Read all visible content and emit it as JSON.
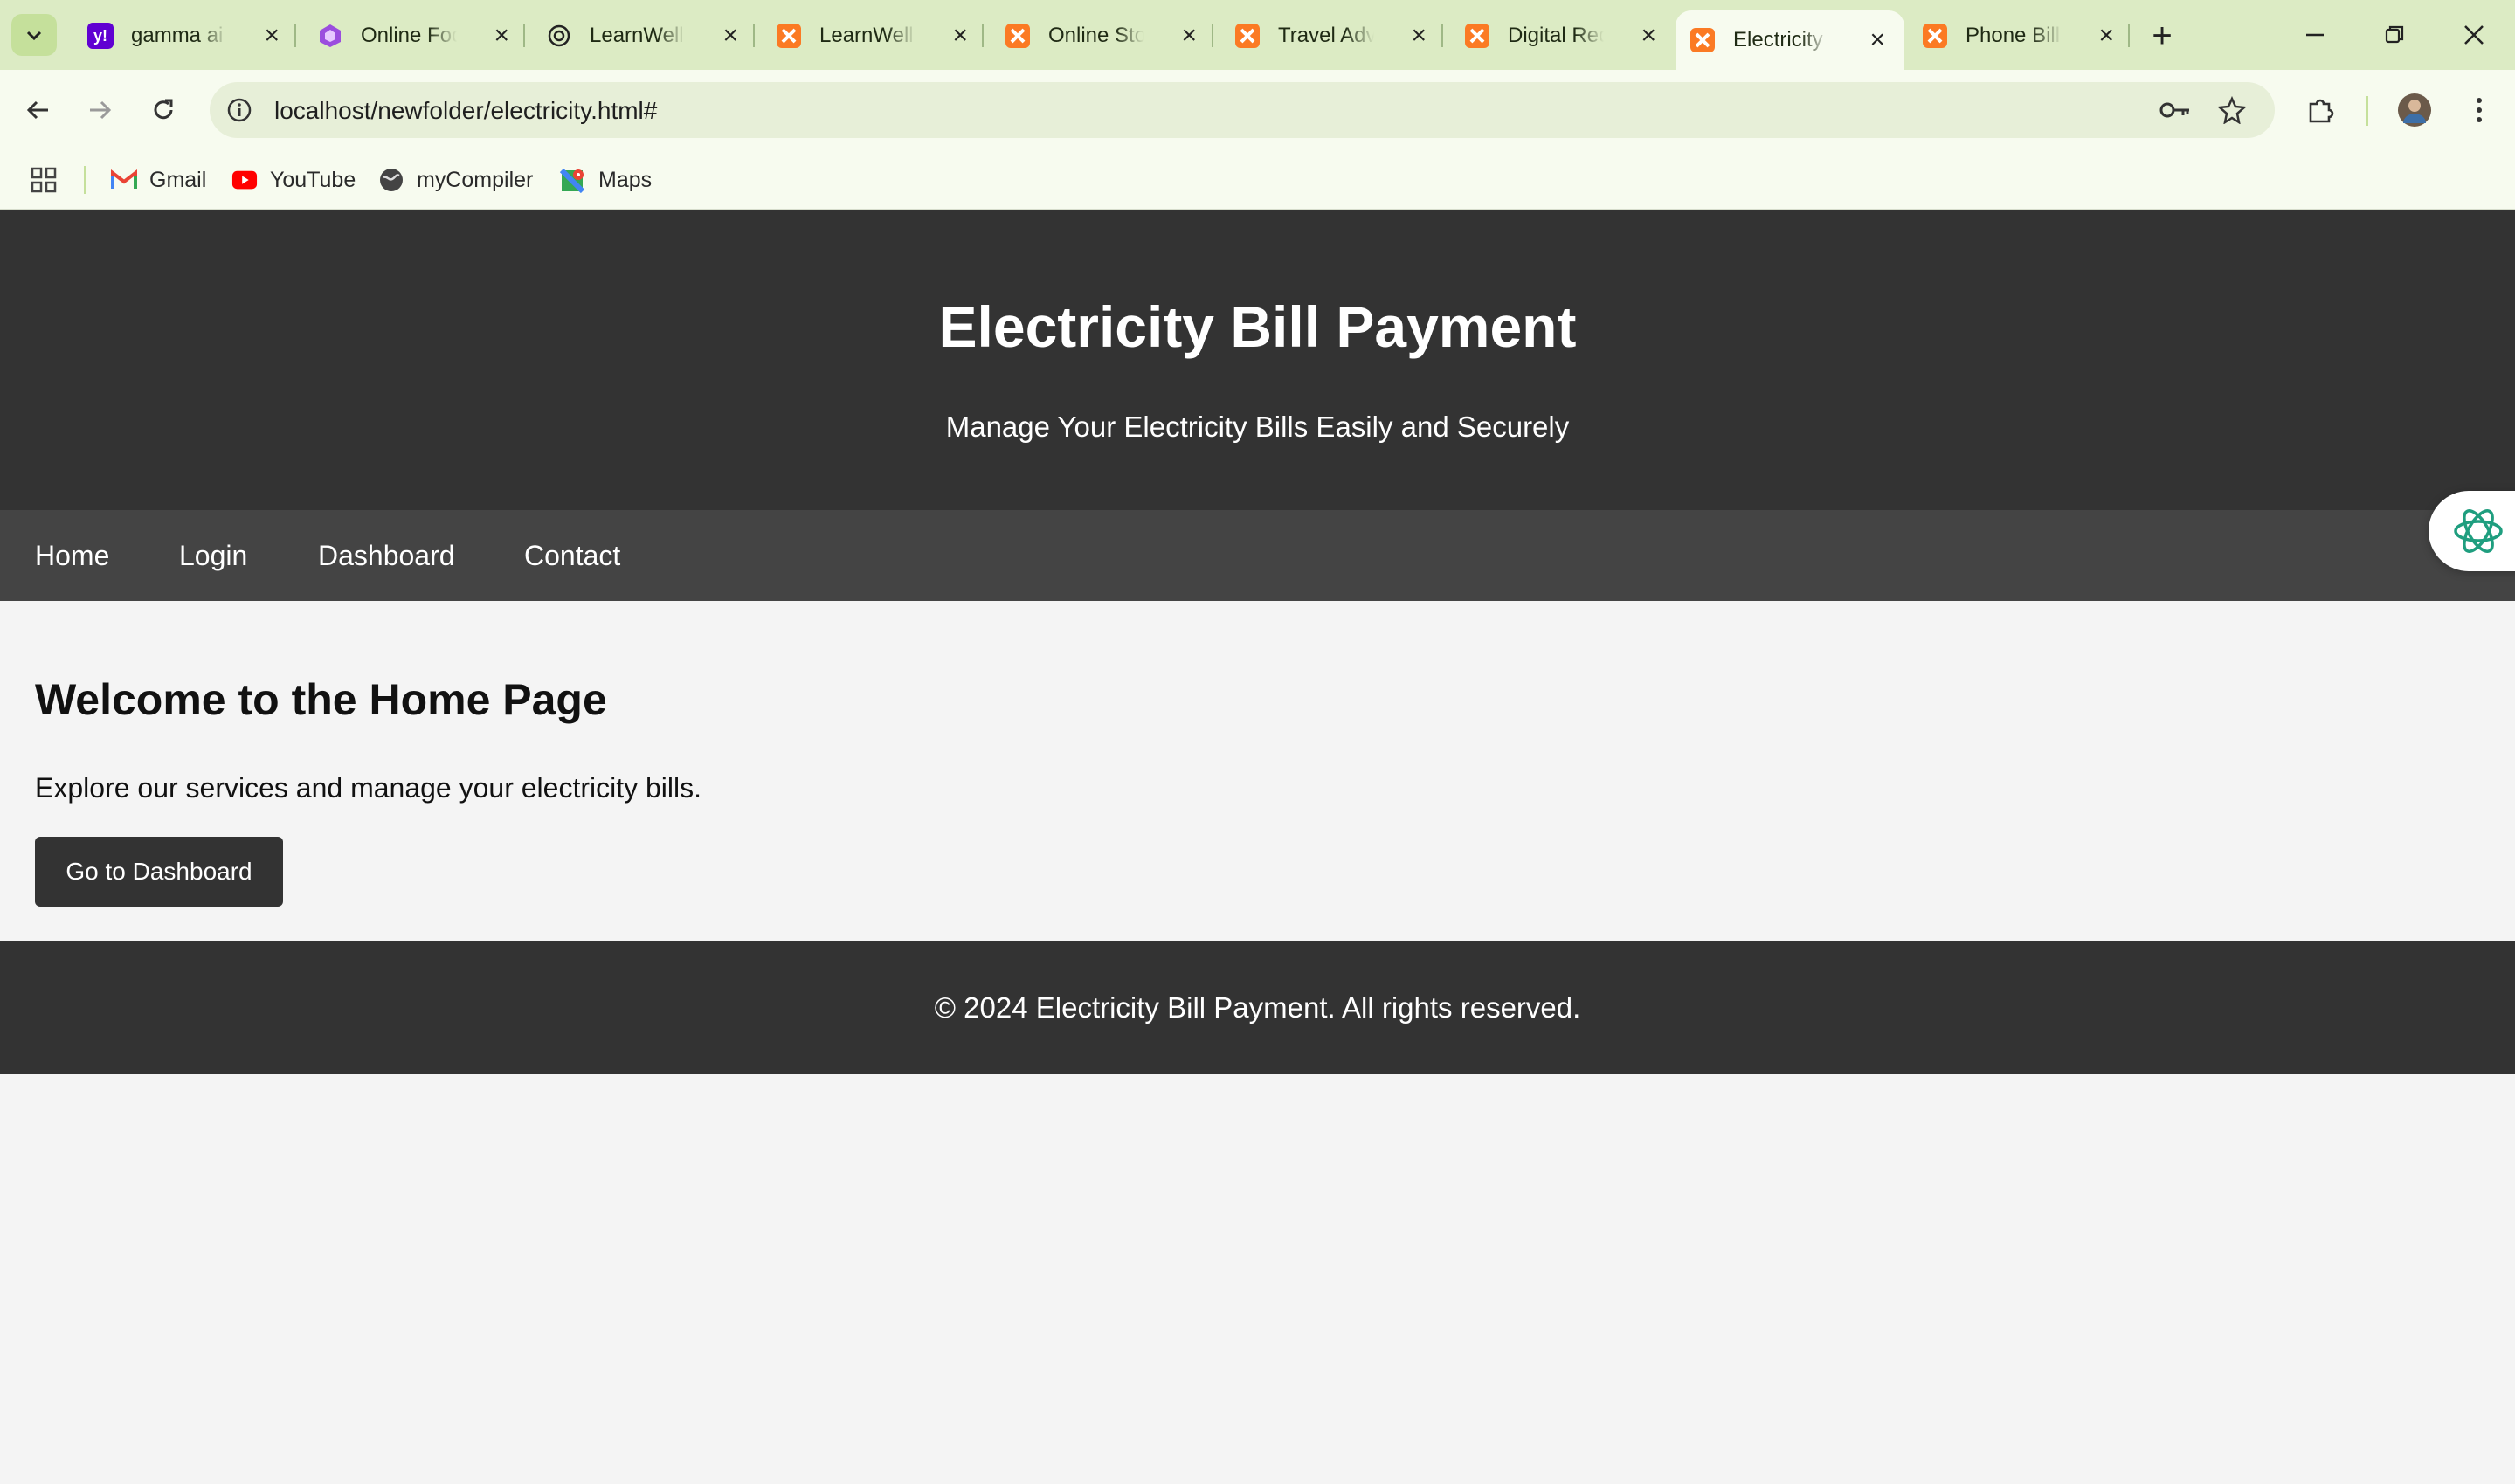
{
  "browser": {
    "tabs": [
      {
        "title": "gamma ai -",
        "favicon": "yahoo-icon",
        "color": "#6001d2"
      },
      {
        "title": "Online Foo",
        "favicon": "gamma-app-icon",
        "color": "#9b4dde"
      },
      {
        "title": "LearnWell V",
        "favicon": "chatgpt-icon",
        "color": "#1f1f1f"
      },
      {
        "title": "LearnWell T",
        "favicon": "xampp-icon",
        "color": "#fb7a24"
      },
      {
        "title": "Online Stor",
        "favicon": "xampp-icon",
        "color": "#fb7a24"
      },
      {
        "title": "Travel Adve",
        "favicon": "xampp-icon",
        "color": "#fb7a24"
      },
      {
        "title": "Digital Rec",
        "favicon": "xampp-icon",
        "color": "#fb7a24"
      },
      {
        "title": "Electricity B",
        "favicon": "xampp-icon",
        "color": "#fb7a24",
        "active": true
      },
      {
        "title": "Phone Bill P",
        "favicon": "xampp-icon",
        "color": "#fb7a24"
      }
    ],
    "url": "localhost/newfolder/electricity.html#",
    "bookmarks": [
      {
        "label": "Gmail",
        "icon": "gmail-icon"
      },
      {
        "label": "YouTube",
        "icon": "youtube-icon"
      },
      {
        "label": "myCompiler",
        "icon": "globe-icon"
      },
      {
        "label": "Maps",
        "icon": "maps-icon"
      }
    ],
    "accent": "#dcebc4"
  },
  "page": {
    "header": {
      "title": "Electricity Bill Payment",
      "subtitle": "Manage Your Electricity Bills Easily and Securely"
    },
    "nav": [
      "Home",
      "Login",
      "Dashboard",
      "Contact"
    ],
    "main": {
      "heading": "Welcome to the Home Page",
      "text": "Explore our services and manage your electricity bills.",
      "button": "Go to Dashboard"
    },
    "footer": "© 2024 Electricity Bill Payment. All rights reserved.",
    "colors": {
      "header": "#333333",
      "nav": "#444444",
      "body": "#f4f4f4"
    }
  }
}
